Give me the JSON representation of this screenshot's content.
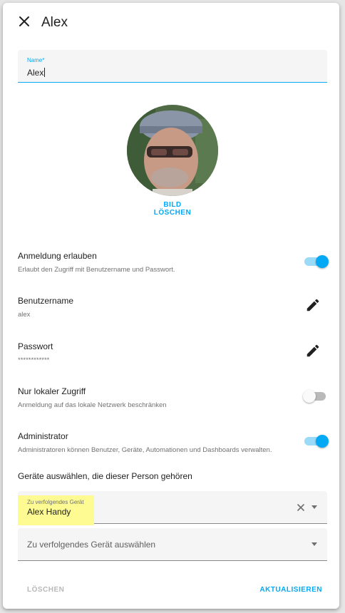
{
  "dialog": {
    "title": "Alex",
    "close_icon": "close-icon"
  },
  "name_field": {
    "label": "Name*",
    "value": "Alex"
  },
  "picture": {
    "delete_label": "BILD LÖSCHEN"
  },
  "settings": [
    {
      "title": "Anmeldung erlauben",
      "subtitle": "Erlaubt den Zugriff mit Benutzername und Passwort.",
      "control": "toggle",
      "on": true
    },
    {
      "title": "Benutzername",
      "subtitle": "alex",
      "control": "edit",
      "icon": "pencil-icon"
    },
    {
      "title": "Passwort",
      "subtitle": "************",
      "control": "edit",
      "icon": "pencil-icon"
    },
    {
      "title": "Nur lokaler Zugriff",
      "subtitle": "Anmeldung auf das lokale Netzwerk beschränken",
      "control": "toggle",
      "on": false
    },
    {
      "title": "Administrator",
      "subtitle": "Administratoren können Benutzer, Geräte, Automationen und Dashboards verwalten.",
      "control": "toggle",
      "on": true
    }
  ],
  "devices": {
    "section_label": "Geräte auswählen, die dieser Person gehören",
    "selected": {
      "label": "Zu verfolgendes Gerät",
      "value": "Alex Handy"
    },
    "empty_select": {
      "placeholder": "Zu verfolgendes Gerät auswählen"
    }
  },
  "footer": {
    "delete_label": "LÖSCHEN",
    "update_label": "AKTUALISIEREN"
  },
  "colors": {
    "accent": "#03a9f4",
    "highlight": "#fdfb91"
  }
}
